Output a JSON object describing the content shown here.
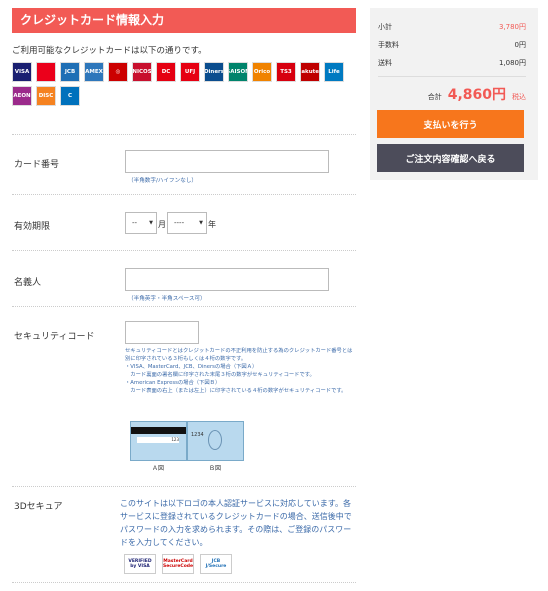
{
  "header": {
    "title": "クレジットカード情報入力"
  },
  "intro": "ご利用可能なクレジットカードは以下の通りです。",
  "card_logos": [
    {
      "name": "VISA",
      "color": "#1a1f71",
      "text": "VISA"
    },
    {
      "name": "MasterCard",
      "color": "#eb001b",
      "text": ""
    },
    {
      "name": "JCB",
      "color": "#1f6fb5",
      "text": "JCB"
    },
    {
      "name": "AMEX",
      "color": "#2e77bb",
      "text": "AMEX"
    },
    {
      "name": "Saison",
      "color": "#cc0000",
      "text": "◎"
    },
    {
      "name": "NICOS",
      "color": "#c8102e",
      "text": "NICOS"
    },
    {
      "name": "DC",
      "color": "#e50012",
      "text": "DC"
    },
    {
      "name": "UFJ",
      "color": "#e60012",
      "text": "UFJ"
    },
    {
      "name": "Diners",
      "color": "#0b4d8e",
      "text": "Diners"
    },
    {
      "name": "SAISON CARD",
      "color": "#00846c",
      "text": "SAISON"
    },
    {
      "name": "Orico",
      "color": "#f08300",
      "text": "Orico"
    },
    {
      "name": "TS3",
      "color": "#d7000f",
      "text": "TS3"
    },
    {
      "name": "Rakuten",
      "color": "#bf0000",
      "text": "Rakuten"
    },
    {
      "name": "Life",
      "color": "#007ac1",
      "text": "Life"
    },
    {
      "name": "AEON",
      "color": "#9b2a8b",
      "text": "AEON"
    },
    {
      "name": "DISCOVER",
      "color": "#f58220",
      "text": "DISC"
    },
    {
      "name": "Cedyna",
      "color": "#0071bc",
      "text": "C"
    }
  ],
  "form": {
    "card_number": {
      "label": "カード番号",
      "note": "（半角数字/ハイフンなし）"
    },
    "expiry": {
      "label": "有効期限",
      "month": "--",
      "year": "----",
      "month_unit": "月",
      "year_unit": "年"
    },
    "name": {
      "label": "名義人",
      "note": "（半角英字・半角スペース可）"
    },
    "security": {
      "label": "セキュリティコード",
      "lines": [
        "セキュリティコードとはクレジットカードの不正利用を防止する為のクレジットカード番号とは別に印字されている３桁もしくは４桁の数字です。",
        "・VISA、MasterCard、JCB、Dinersの場合（下図Ａ）",
        "　カード裏面の署名欄に印字された末尾３桁の数字がセキュリティコードです。",
        "・American Expressの場合（下図Ｂ）",
        "　カード表面の右上（または左上）に印字されている４桁の数字がセキュリティコードです。"
      ],
      "card_a_label": "Ａ図",
      "card_b_label": "Ｂ図",
      "card_a_num": "123",
      "card_b_num": "1234"
    },
    "three_d": {
      "label": "3Dセキュア",
      "text": "このサイトは以下ロゴの本人認証サービスに対応しています。各サービスに登録されているクレジットカードの場合、送信後中でパスワードの入力を求められます。その際は、ご登録のパスワードを入力してください。",
      "logos": [
        {
          "name": "VISA認証サービス",
          "text": "VERIFIED by VISA",
          "color": "#1a1f71"
        },
        {
          "name": "MasterCard SecureCode",
          "text": "MasterCard SecureCode",
          "color": "#cc0000"
        },
        {
          "name": "JCB J/Secure",
          "text": "JCB J/Secure",
          "color": "#1f6fb5"
        }
      ]
    }
  },
  "summary": {
    "subtotal_label": "小計",
    "subtotal": "3,780円",
    "fee_label": "手数料",
    "fee": "0円",
    "shipping_label": "送料",
    "shipping": "1,080円",
    "total_label": "合計",
    "total": "4,860円",
    "tax_label": "税込"
  },
  "buttons": {
    "pay": "支払いを行う",
    "back": "ご注文内容確認へ戻る"
  },
  "colors": {
    "accent": "#f25a55",
    "pay": "#f7761c",
    "back": "#4c4c5a",
    "link": "#3a69a8"
  }
}
